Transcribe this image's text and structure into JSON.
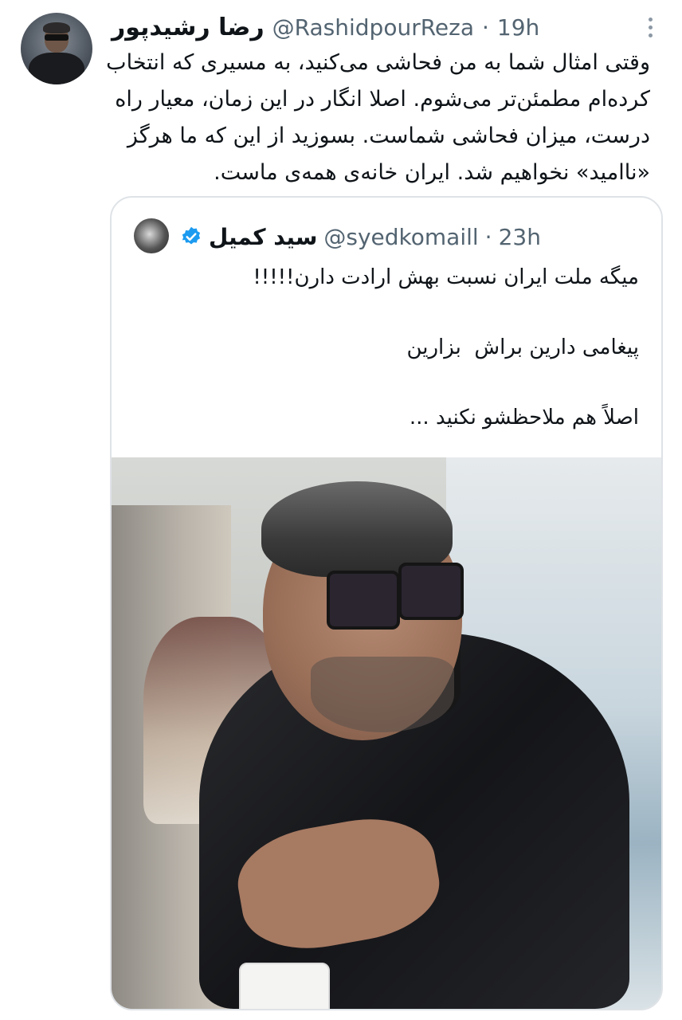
{
  "tweet": {
    "display_name": "رضا رشیدپور",
    "handle": "@RashidpourReza",
    "separator": "·",
    "time": "19h",
    "text": "وقتی امثال شما به من فحاشی می‌کنید، به مسیری که انتخاب کرده‌ام مطمئن‌تر می‌شوم. اصلا انگار در این زمان، معیار راه درست، میزان فحاشی شماست. بسوزید از این که ما هرگز «ناامید» نخواهیم شد. ایران خانه‌ی همه‌ی ماست."
  },
  "quoted_tweet": {
    "display_name": "سید کمیل",
    "handle": "@syedkomaill",
    "separator": "·",
    "time": "23h",
    "text": "میگه ملت ایران نسبت بهش ارادت دارن!!!!!\n\nپیغامی دارین براش  بزارین\n\nاصلاً هم ملاحظشو نکنید ...",
    "verified": true
  },
  "icons": {
    "more": "more-vertical-icon",
    "verified": "verified-badge-icon"
  },
  "colors": {
    "text": "#0f1419",
    "secondary": "#536471",
    "border": "#dfe3e7",
    "verified": "#1d9bf0"
  }
}
